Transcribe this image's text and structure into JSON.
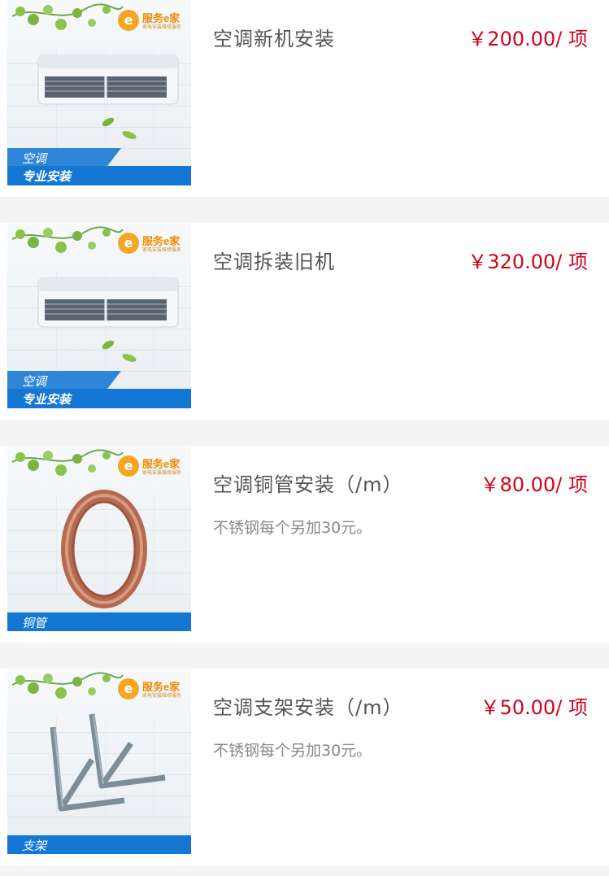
{
  "brand": {
    "name": "服务e家",
    "logo_letter": "e",
    "tagline": "家电安装维修服务",
    "color": "#f08a00"
  },
  "accent_colors": {
    "price": "#d0021b",
    "banner": "#1477d4"
  },
  "items": [
    {
      "title": "空调新机安装",
      "price": "￥200.00/ 项",
      "note": "",
      "banner_line1": "空调",
      "banner_line2": "专业安装",
      "product_icon": "air-conditioner-icon"
    },
    {
      "title": "空调拆装旧机",
      "price": "￥320.00/ 项",
      "note": "",
      "banner_line1": "空调",
      "banner_line2": "专业安装",
      "product_icon": "air-conditioner-icon"
    },
    {
      "title": "空调铜管安装（/m）",
      "price": "￥80.00/ 项",
      "note": "不锈钢每个另加30元。",
      "banner_line1": "铜管",
      "banner_line2": "",
      "product_icon": "copper-pipe-coil-icon"
    },
    {
      "title": "空调支架安装（/m）",
      "price": "￥50.00/ 项",
      "note": "不锈钢每个另加30元。",
      "banner_line1": "支架",
      "banner_line2": "",
      "product_icon": "ac-bracket-icon"
    }
  ]
}
